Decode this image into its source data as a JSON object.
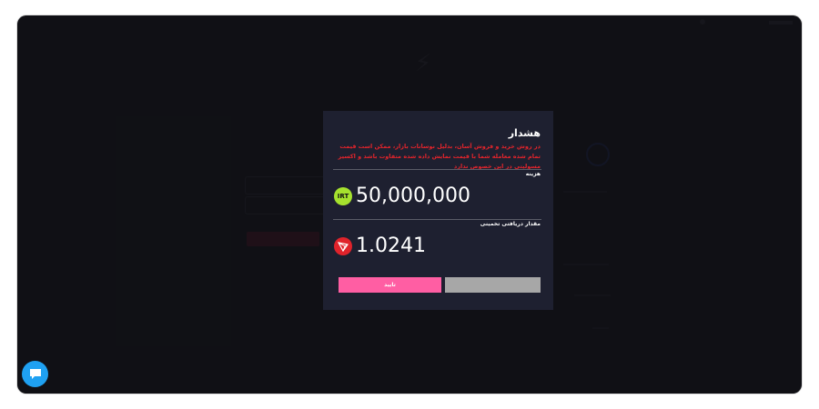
{
  "colors": {
    "frame_bg": "#26272d",
    "modal_bg": "#1e2030",
    "warning_text": "#e3242b",
    "confirm_button": "#ff5ea3",
    "cancel_button": "#a7a7a7",
    "irt_coin": "#a6e22e",
    "trx_coin": "#e0232b",
    "chat_button": "#1fa1f2"
  },
  "modal": {
    "title": "هشدار",
    "warning": "در روش خرید و فروش آسان، بدلیل نوسانات بازار، ممکن است قیمت تمام شده معامله شما با قیمت نمایش داده شده متفاوت باشد و اکسیر مسولیتی در این خصوص ندارد",
    "cost_label": "هزینه",
    "cost_amount": "50,000,000",
    "cost_currency_badge": "IRT",
    "estimate_label": "مقدار دریافتی تخمینی",
    "estimate_amount": "1.0241",
    "estimate_coin_icon": "tron-icon",
    "confirm_label": "تایید",
    "cancel_label": ""
  },
  "chat": {
    "icon": "chat-icon"
  }
}
